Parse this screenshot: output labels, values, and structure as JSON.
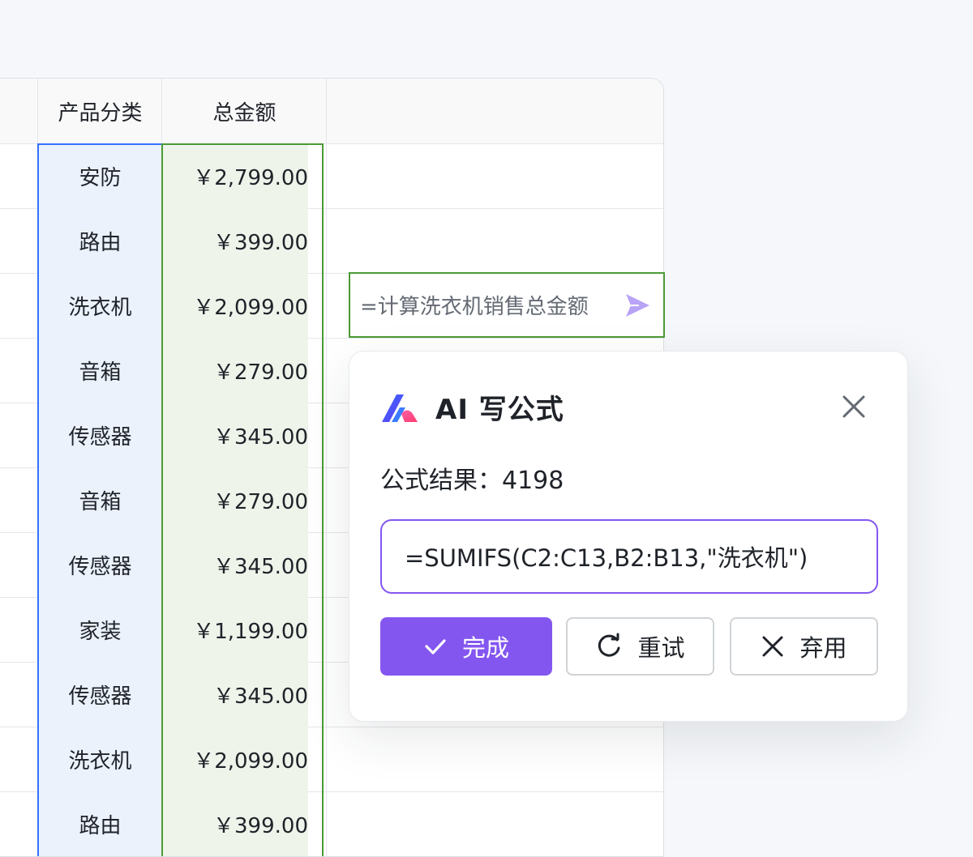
{
  "sheet": {
    "headers": {
      "category": "产品分类",
      "total": "总金额"
    },
    "rows": [
      {
        "category": "安防",
        "amount": "￥2,799.00"
      },
      {
        "category": "路由",
        "amount": "￥399.00"
      },
      {
        "category": "洗衣机",
        "amount": "￥2,099.00"
      },
      {
        "category": "音箱",
        "amount": "￥279.00"
      },
      {
        "category": "传感器",
        "amount": "￥345.00"
      },
      {
        "category": "音箱",
        "amount": "￥279.00"
      },
      {
        "category": "传感器",
        "amount": "￥345.00"
      },
      {
        "category": "家装",
        "amount": "￥1,199.00"
      },
      {
        "category": "传感器",
        "amount": "￥345.00"
      },
      {
        "category": "洗衣机",
        "amount": "￥2,099.00"
      },
      {
        "category": "路由",
        "amount": "￥399.00"
      }
    ]
  },
  "prompt": {
    "text": "=计算洗衣机销售总金额",
    "send_icon": "send-icon"
  },
  "dialog": {
    "title": "AI 写公式",
    "result_label": "公式结果：",
    "result_value": "4198",
    "formula": "=SUMIFS(C2:C13,B2:B13,\"洗衣机\")",
    "buttons": {
      "done": "完成",
      "retry": "重试",
      "discard": "弃用"
    },
    "colors": {
      "accent": "#8456f0",
      "selection_green": "#4b9a34",
      "selection_blue": "#3370ff"
    }
  }
}
